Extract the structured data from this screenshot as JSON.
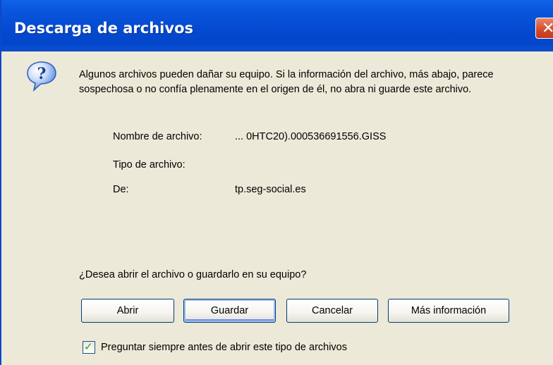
{
  "window": {
    "title": "Descarga de archivos",
    "close_glyph": "✕"
  },
  "dialog": {
    "icon": "help-question-icon",
    "message": "Algunos archivos pueden dañar su equipo. Si la información del archivo, más abajo, parece sospechosa o no confía plenamente en el origen de él, no abra ni guarde este archivo.",
    "file_info": {
      "name_label": "Nombre de archivo:",
      "name_value": "... 0HTC20).000536691556.GISS",
      "type_label": "Tipo de archivo:",
      "type_value": "",
      "from_label": "De:",
      "from_value": "tp.seg-social.es"
    },
    "question": "¿Desea abrir el archivo o guardarlo en su equipo?",
    "buttons": {
      "open": "Abrir",
      "save": "Guardar",
      "cancel": "Cancelar",
      "more_info": "Más información"
    },
    "checkbox": {
      "label": "Preguntar siempre antes de abrir este tipo de archivos",
      "checked": true,
      "check_glyph": "✓"
    }
  },
  "colors": {
    "titlebar": "#0449d0",
    "dialog_bg": "#ece9d8",
    "close_button": "#d24a2a",
    "help_icon": "#2d6ed2"
  }
}
